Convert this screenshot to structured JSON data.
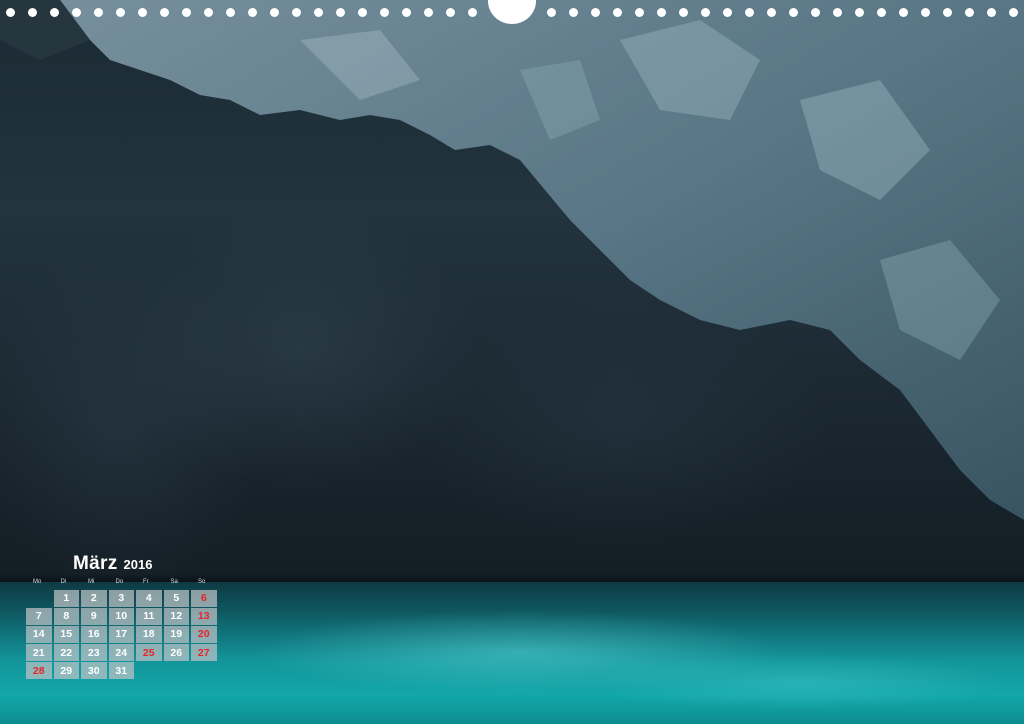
{
  "calendar": {
    "month": "März",
    "year": "2016",
    "weekdays": [
      "Mo",
      "Di",
      "Mi",
      "Do",
      "Fr",
      "Sa",
      "So"
    ],
    "leading_blanks": 1,
    "days": [
      "1",
      "2",
      "3",
      "4",
      "5",
      "6",
      "7",
      "8",
      "9",
      "10",
      "11",
      "12",
      "13",
      "14",
      "15",
      "16",
      "17",
      "18",
      "19",
      "20",
      "21",
      "22",
      "23",
      "24",
      "25",
      "26",
      "27",
      "28",
      "29",
      "30",
      "31"
    ],
    "highlighted_days": [
      "6",
      "13",
      "20",
      "25",
      "27",
      "28"
    ],
    "highlight_color": "#e8232a"
  },
  "photo": {
    "icon": "sea-cave-photo"
  }
}
